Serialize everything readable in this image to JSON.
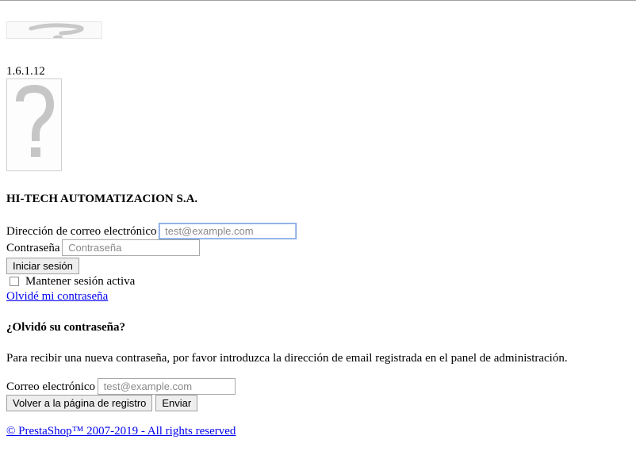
{
  "version": "1.6.1.12",
  "shop_name": "HI-TECH AUTOMATIZACION S.A.",
  "login": {
    "email_label": "Dirección de correo electrónico",
    "email_placeholder": " test@example.com",
    "password_label": "Contraseña",
    "password_placeholder": " Contraseña",
    "submit_label": "Iniciar sesión",
    "stay_logged_in_label": "Mantener sesión activa",
    "stay_logged_in_checked": false,
    "forgot_link": "Olvidé mi contraseña"
  },
  "forgot": {
    "heading": "¿Olvidó su contraseña?",
    "instructions": "Para recibir una nueva contraseña, por favor introduzca la dirección de email registrada en el panel de administración.",
    "email_label": "Correo electrónico",
    "email_placeholder": " test@example.com",
    "back_label": "Volver a la página de registro",
    "send_label": "Enviar"
  },
  "footer": {
    "copyright": "© PrestaShop™ 2007-2019 - All rights reserved"
  },
  "icons": {
    "logo": "broken-image-icon",
    "admin_avatar": "broken-image-icon",
    "input_prefix": "missing-glyph-icon"
  }
}
